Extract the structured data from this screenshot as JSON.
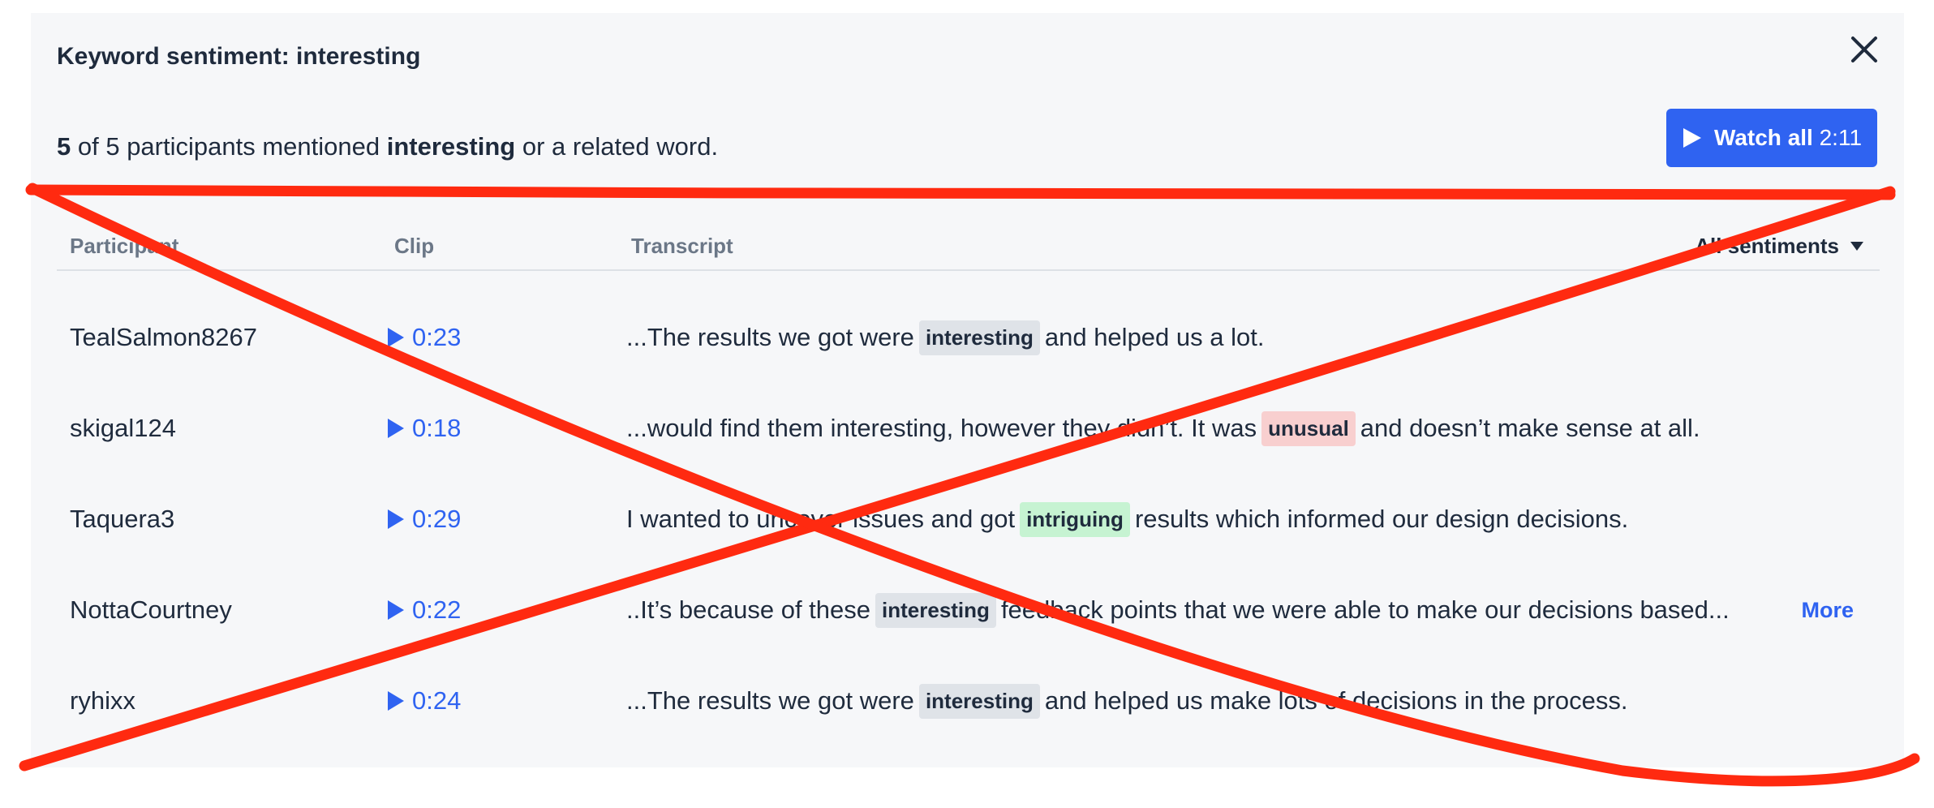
{
  "title": "Keyword sentiment: interesting",
  "summary": {
    "count": "5",
    "of_text": "of 5 participants mentioned",
    "keyword": "interesting",
    "suffix": "or a related word."
  },
  "watch_all": {
    "label": "Watch all",
    "duration": "2:11"
  },
  "columns": {
    "participant": "Participant",
    "clip": "Clip",
    "transcript": "Transcript",
    "sentiments": "All sentiments"
  },
  "rows": [
    {
      "participant": "TealSalmon8267",
      "clip": "0:23",
      "before": "...The results we got were",
      "keyword": "interesting",
      "sentiment": "neutral",
      "after": "and helped us a lot."
    },
    {
      "participant": "skigal124",
      "clip": "0:18",
      "before": "...would find them interesting, however they didn’t. It was",
      "keyword": "unusual",
      "sentiment": "negative",
      "after": "and doesn’t make sense at all."
    },
    {
      "participant": "Taquera3",
      "clip": "0:29",
      "before": "I wanted to uncover issues and got",
      "keyword": "intriguing",
      "sentiment": "positive",
      "after": "results which informed our design decisions."
    },
    {
      "participant": "NottaCourtney",
      "clip": "0:22",
      "before": "..It’s because of these",
      "keyword": "interesting",
      "sentiment": "neutral",
      "after": "feedback points that we were able to make our decisions based...",
      "more": "More"
    },
    {
      "participant": "ryhixx",
      "clip": "0:24",
      "before": "...The results we got were",
      "keyword": "interesting",
      "sentiment": "neutral",
      "after": "and helped us make lots of decisions in the process."
    }
  ],
  "colors": {
    "accent": "#2f63f1",
    "neutral_tag": "#dfe3e8",
    "negative_tag": "#f8cfcf",
    "positive_tag": "#c6f3d2",
    "strike_overlay": "#ff2a10"
  },
  "icons": {
    "close": "close-icon",
    "play": "play-icon",
    "dropdown": "caret-down-icon"
  }
}
